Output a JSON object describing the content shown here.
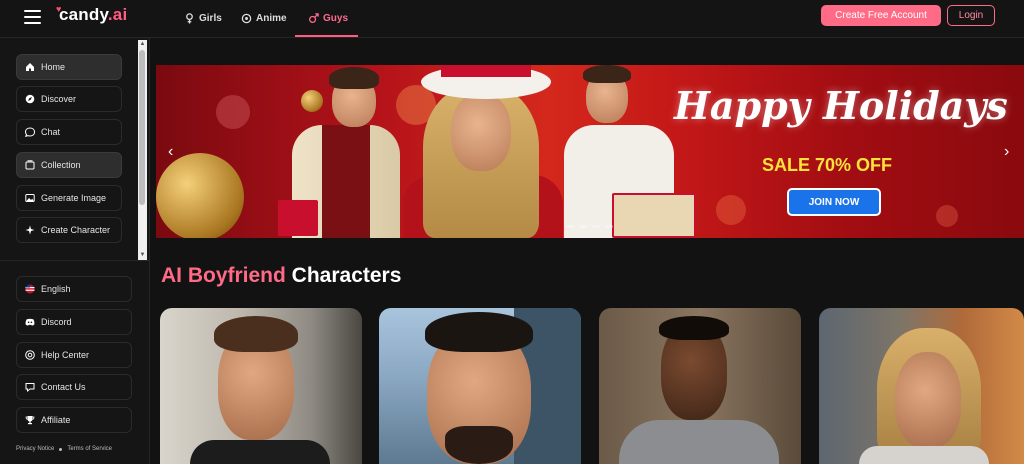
{
  "header": {
    "logo_prefix": "c",
    "logo_main": "andy",
    "logo_suffix": ".ai",
    "tabs": [
      {
        "label": "Girls",
        "icon": "female-icon"
      },
      {
        "label": "Anime",
        "icon": "anime-icon"
      },
      {
        "label": "Guys",
        "icon": "male-icon",
        "active": true
      }
    ],
    "create_account_label": "Create Free Account",
    "login_label": "Login"
  },
  "sidebar": {
    "items": [
      {
        "label": "Home",
        "icon": "home-icon",
        "highlighted": true
      },
      {
        "label": "Discover",
        "icon": "compass-icon"
      },
      {
        "label": "Chat",
        "icon": "chat-icon"
      },
      {
        "label": "Collection",
        "icon": "collection-icon",
        "highlighted": true
      },
      {
        "label": "Generate Image",
        "icon": "image-icon"
      },
      {
        "label": "Create Character",
        "icon": "sparkle-icon"
      }
    ],
    "bottom_items": [
      {
        "label": "English",
        "icon": "flag-icon"
      },
      {
        "label": "Discord",
        "icon": "discord-icon"
      },
      {
        "label": "Help Center",
        "icon": "help-icon"
      },
      {
        "label": "Contact Us",
        "icon": "contact-icon"
      },
      {
        "label": "Affiliate",
        "icon": "trophy-icon"
      }
    ],
    "privacy_label": "Privacy Notice",
    "terms_label": "Terms of Service"
  },
  "banner": {
    "headline": "Happy Holidays",
    "sale_text": "SALE 70% OFF",
    "cta_label": "JOIN NOW",
    "prev_arrow": "‹",
    "next_arrow": "›"
  },
  "section": {
    "title_highlight": "AI Boyfriend",
    "title_rest": " Characters"
  },
  "colors": {
    "accent": "#ff6b86",
    "background": "#121212",
    "cta_blue": "#1a73e8",
    "sale_yellow": "#ffe23a"
  }
}
